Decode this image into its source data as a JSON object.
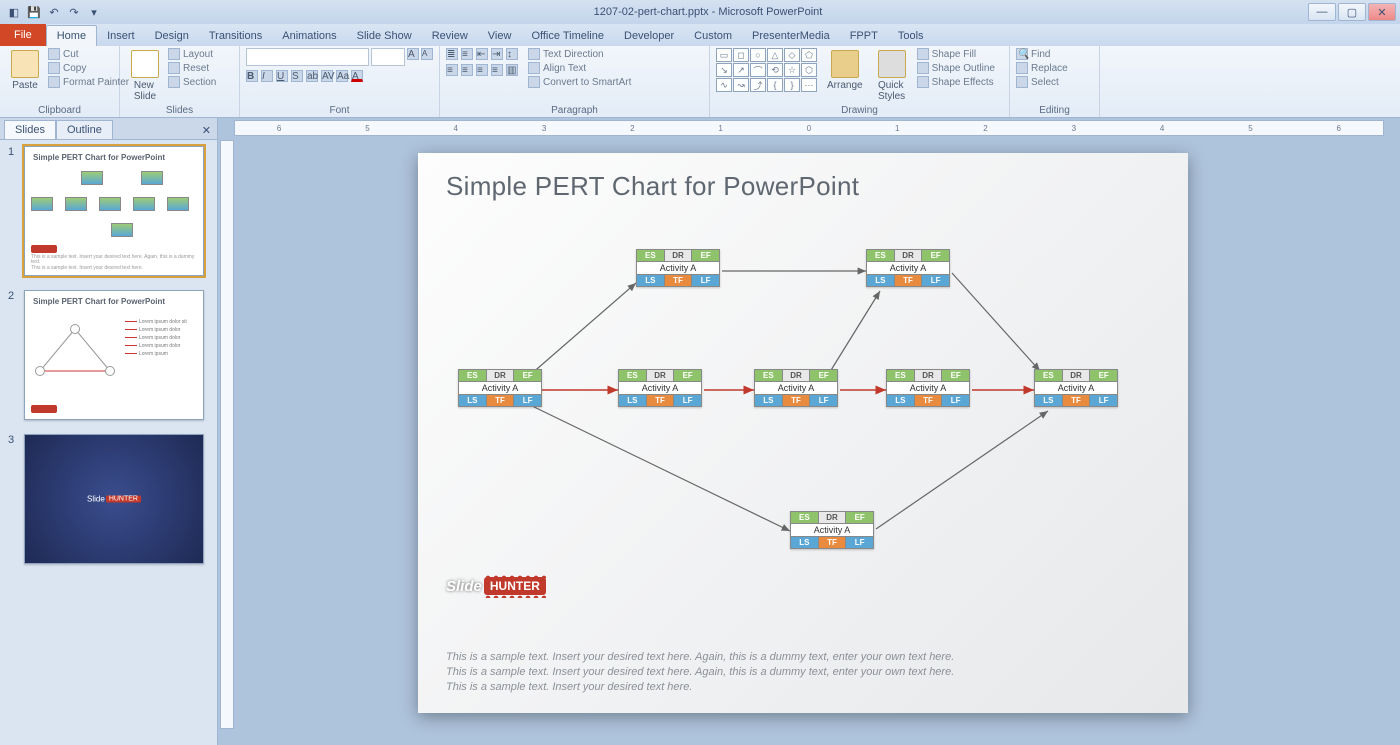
{
  "window": {
    "title": "1207-02-pert-chart.pptx - Microsoft PowerPoint"
  },
  "tabs": {
    "file": "File",
    "items": [
      "Home",
      "Insert",
      "Design",
      "Transitions",
      "Animations",
      "Slide Show",
      "Review",
      "View",
      "Office Timeline",
      "Developer",
      "Custom",
      "PresenterMedia",
      "FPPT",
      "Tools"
    ],
    "active": "Home"
  },
  "ribbon": {
    "clipboard": {
      "label": "Clipboard",
      "paste": "Paste",
      "cut": "Cut",
      "copy": "Copy",
      "fmt": "Format Painter"
    },
    "slides": {
      "label": "Slides",
      "new": "New\nSlide",
      "layout": "Layout",
      "reset": "Reset",
      "section": "Section"
    },
    "font": {
      "label": "Font"
    },
    "paragraph": {
      "label": "Paragraph",
      "dir": "Text Direction",
      "align": "Align Text",
      "smart": "Convert to SmartArt"
    },
    "drawing": {
      "label": "Drawing",
      "arrange": "Arrange",
      "quick": "Quick\nStyles",
      "fill": "Shape Fill",
      "outline": "Shape Outline",
      "effects": "Shape Effects"
    },
    "editing": {
      "label": "Editing",
      "find": "Find",
      "replace": "Replace",
      "select": "Select"
    }
  },
  "panel": {
    "tab_slides": "Slides",
    "tab_outline": "Outline",
    "t1": "Simple PERT Chart for PowerPoint",
    "t2": "Simple PERT Chart for PowerPoint"
  },
  "slide": {
    "title": "Simple PERT Chart for PowerPoint",
    "node": {
      "es": "ES",
      "dr": "DR",
      "ef": "EF",
      "ls": "LS",
      "tf": "TF",
      "lf": "LF",
      "act": "Activity A"
    },
    "wm_a": "Slide",
    "wm_b": "HUNTER",
    "lorem": "This is a sample text. Insert your desired text here. Again, this is a dummy text, enter your own text here.\nThis is a sample text. Insert your desired text here. Again, this is a dummy text, enter your own text here.\nThis is a sample text. Insert your desired text here."
  },
  "ruler": [
    "6",
    "5",
    "4",
    "3",
    "2",
    "1",
    "0",
    "1",
    "2",
    "3",
    "4",
    "5",
    "6"
  ]
}
